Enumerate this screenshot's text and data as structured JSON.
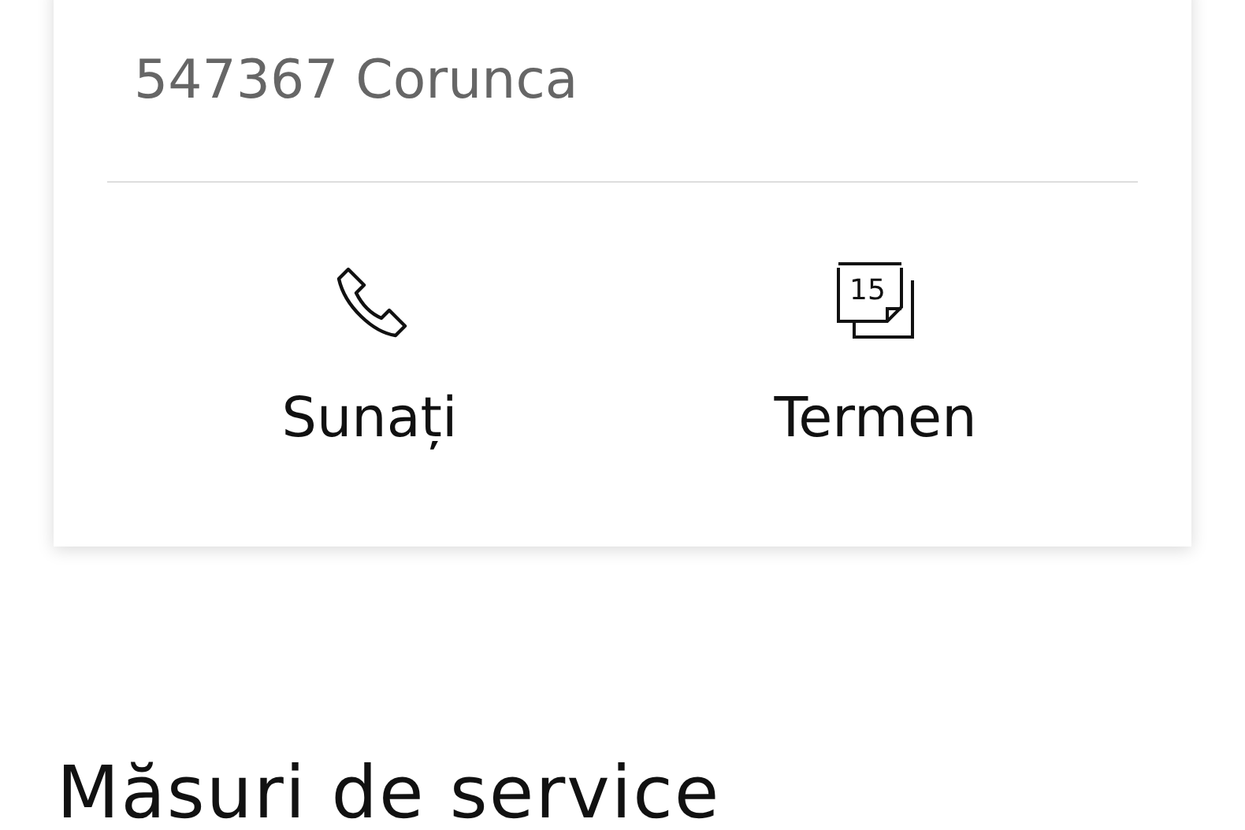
{
  "address": {
    "lines": [
      "547367 Corunca"
    ]
  },
  "actions": [
    {
      "kind": "call",
      "label": "Sunați"
    },
    {
      "kind": "appointment",
      "label": "Termen",
      "icon_text": "15"
    }
  ],
  "section": {
    "title": "Măsuri de service"
  }
}
